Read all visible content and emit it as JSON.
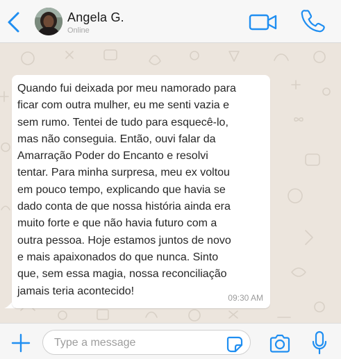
{
  "header": {
    "contact_name": "Angela G.",
    "status": "Online",
    "icons": {
      "back": "chevron-left-icon",
      "video": "video-camera-icon",
      "call": "phone-icon"
    }
  },
  "message": {
    "text": "Quando fui deixada por meu namorado para\nficar com outra mulher, eu me senti vazia e\nsem rumo. Tentei de tudo para esquecê-lo,\nmas não conseguia. Então, ouvi falar da\nAmarração Poder do Encanto e resolvi\ntentar. Para minha surpresa, meu ex voltou\nem pouco tempo, explicando que havia se\ndado conta de que nossa história ainda era\nmuito forte e que não havia futuro com a\noutra pessoa. Hoje estamos juntos de novo\ne mais apaixonados do que nunca. Sinto\nque, sem essa magia, nossa reconciliação\njamais teria acontecido!",
    "time": "09:30 AM",
    "direction": "incoming"
  },
  "composer": {
    "placeholder": "Type a message",
    "value": "",
    "icons": {
      "add": "plus-icon",
      "sticker": "sticker-icon",
      "camera": "camera-icon",
      "mic": "microphone-icon"
    }
  },
  "colors": {
    "accent": "#1f8ef1",
    "chat_background": "#ece5dd",
    "bubble": "#ffffff",
    "header": "#f7f7f7"
  }
}
